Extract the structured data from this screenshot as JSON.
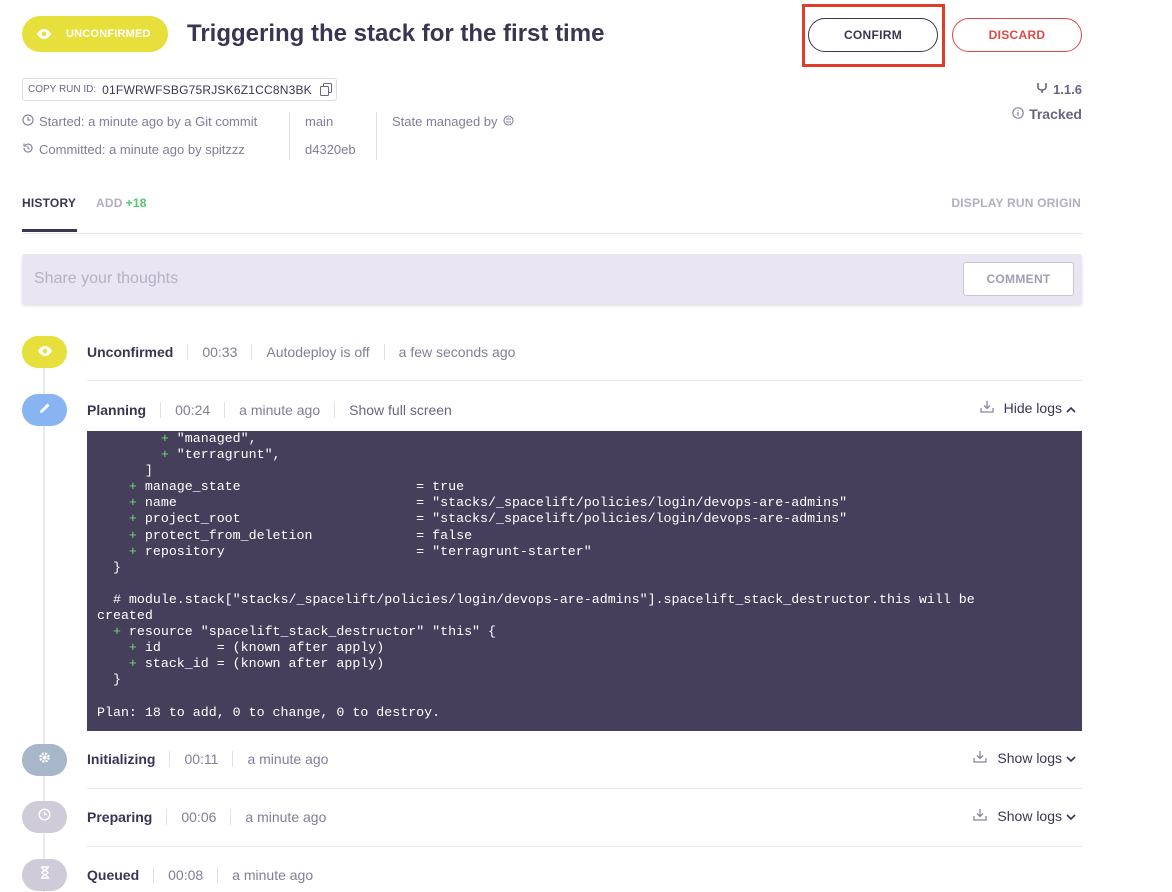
{
  "header": {
    "status": "UNCONFIRMED",
    "title": "Triggering the stack for the first time",
    "confirm_label": "CONFIRM",
    "discard_label": "DISCARD"
  },
  "run": {
    "copy_label": "COPY RUN ID:",
    "run_id": "01FWRWFSBG75RJSK6Z1CC8N3BK",
    "started": "Started: a minute ago by a Git commit",
    "committed": "Committed: a minute ago by spitzzz",
    "branch": "main",
    "commit": "d4320eb",
    "state_managed": "State managed by",
    "version": "1.1.6",
    "tracked": "Tracked"
  },
  "tabs": {
    "history": "HISTORY",
    "add": "ADD",
    "add_count": "+18",
    "display_origin": "DISPLAY RUN ORIGIN"
  },
  "comment": {
    "placeholder": "Share your thoughts",
    "button": "COMMENT"
  },
  "steps": {
    "unconfirmed": {
      "name": "Unconfirmed",
      "duration": "00:33",
      "note": "Autodeploy is off",
      "time": "a few seconds ago"
    },
    "planning": {
      "name": "Planning",
      "duration": "00:24",
      "time": "a minute ago",
      "fullscreen": "Show full screen",
      "logs": "Hide logs"
    },
    "initializing": {
      "name": "Initializing",
      "duration": "00:11",
      "time": "a minute ago",
      "logs": "Show logs"
    },
    "preparing": {
      "name": "Preparing",
      "duration": "00:06",
      "time": "a minute ago",
      "logs": "Show logs"
    },
    "queued": {
      "name": "Queued",
      "duration": "00:08",
      "time": "a minute ago"
    }
  },
  "log_lines": [
    {
      "indent": "        ",
      "plus": "+",
      "text": " \"managed\","
    },
    {
      "indent": "        ",
      "plus": "+",
      "text": " \"terragrunt\","
    },
    {
      "indent": "      ",
      "plus": "",
      "text": "]"
    },
    {
      "indent": "    ",
      "plus": "+",
      "text": " manage_state                      = true"
    },
    {
      "indent": "    ",
      "plus": "+",
      "text": " name                              = \"stacks/_spacelift/policies/login/devops-are-admins\""
    },
    {
      "indent": "    ",
      "plus": "+",
      "text": " project_root                      = \"stacks/_spacelift/policies/login/devops-are-admins\""
    },
    {
      "indent": "    ",
      "plus": "+",
      "text": " protect_from_deletion             = false"
    },
    {
      "indent": "    ",
      "plus": "+",
      "text": " repository                        = \"terragrunt-starter\""
    },
    {
      "indent": "  ",
      "plus": "",
      "text": "}"
    },
    {
      "indent": "",
      "plus": "",
      "text": ""
    },
    {
      "indent": "  ",
      "plus": "",
      "text": "# module.stack[\"stacks/_spacelift/policies/login/devops-are-admins\"].spacelift_stack_destructor.this will be"
    },
    {
      "indent": "",
      "plus": "",
      "text": "created"
    },
    {
      "indent": "  ",
      "plus": "+",
      "text": " resource \"spacelift_stack_destructor\" \"this\" {"
    },
    {
      "indent": "    ",
      "plus": "+",
      "text": " id       = (known after apply)"
    },
    {
      "indent": "    ",
      "plus": "+",
      "text": " stack_id = (known after apply)"
    },
    {
      "indent": "  ",
      "plus": "",
      "text": "}"
    },
    {
      "indent": "",
      "plus": "",
      "text": ""
    },
    {
      "indent": "",
      "plus": "",
      "text": "Plan: 18 to add, 0 to change, 0 to destroy."
    }
  ],
  "colors": {
    "unconfirmed": "#e6df3c",
    "planning": "#88b4f2",
    "initializing": "#a8b6c9",
    "preparing": "#cfcbd9",
    "queued": "#cfcbd9",
    "log_bg": "#463f5c",
    "confirm_highlight": "#e03c2a",
    "discard": "#e04848"
  }
}
